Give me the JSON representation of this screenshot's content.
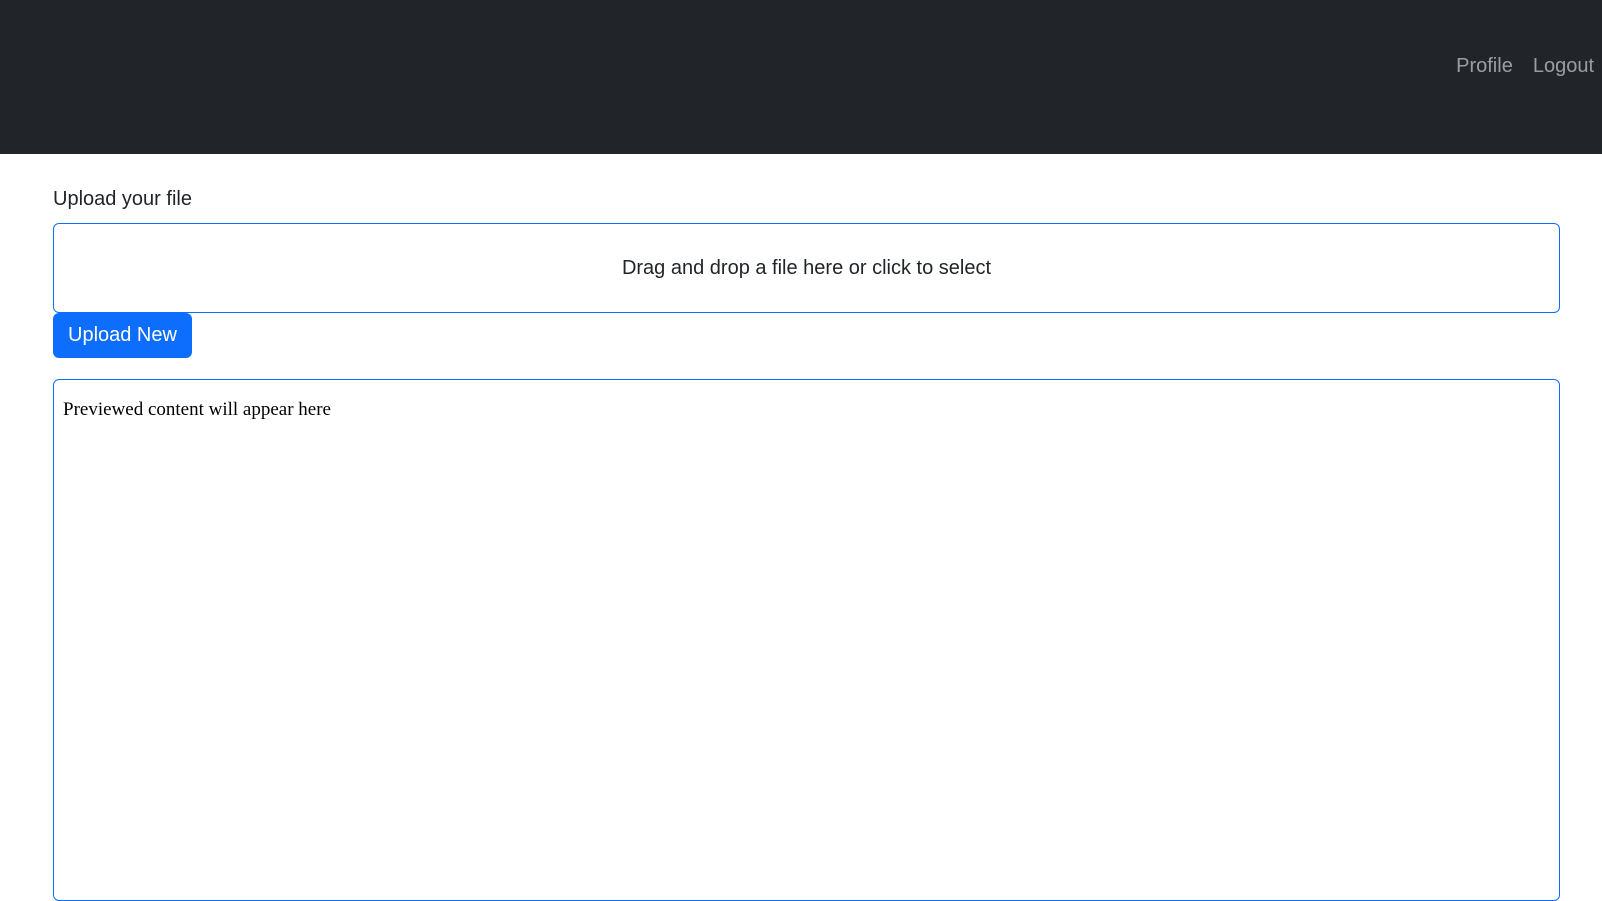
{
  "navbar": {
    "links": [
      {
        "label": "Profile"
      },
      {
        "label": "Logout"
      }
    ]
  },
  "upload": {
    "label": "Upload your file",
    "dropzone_text": "Drag and drop a file here or click to select",
    "button_label": "Upload New"
  },
  "preview": {
    "placeholder": "Previewed content will appear here"
  },
  "colors": {
    "navbar_bg": "#212529",
    "accent": "#0d6efd"
  }
}
